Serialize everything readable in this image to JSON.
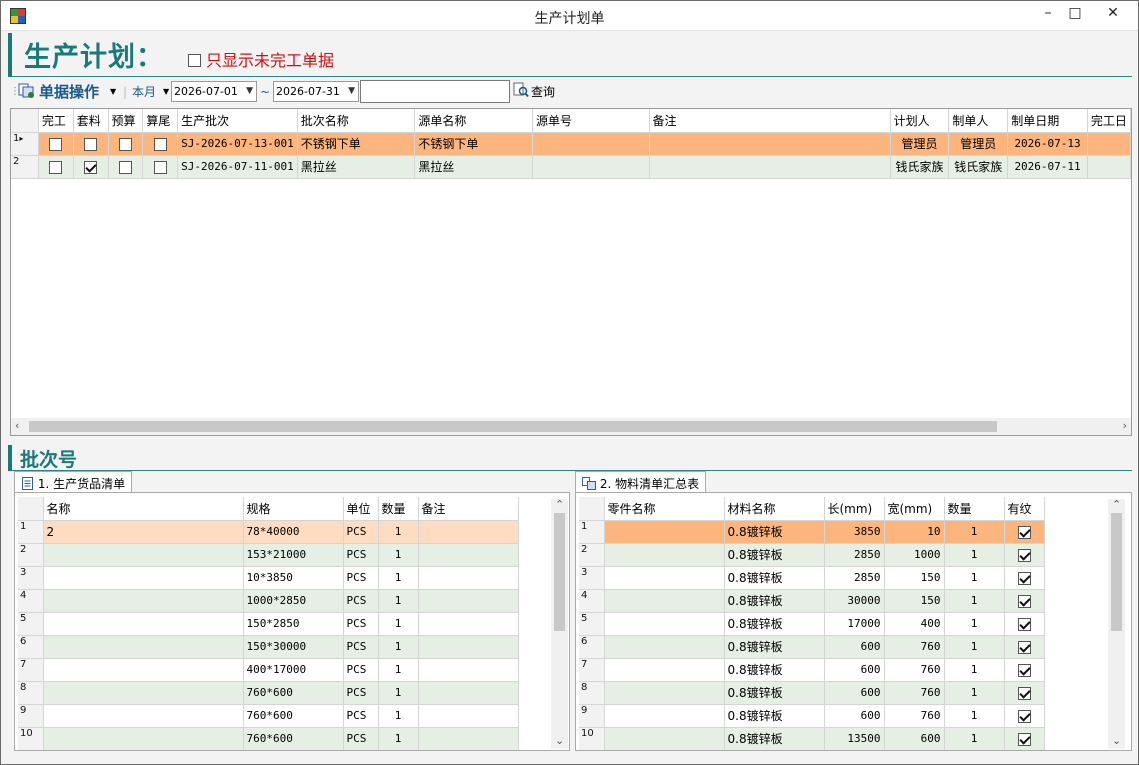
{
  "window": {
    "title": "生产计划单",
    "minimize": "–",
    "maximize": "□",
    "close": "✕"
  },
  "header": {
    "title": "生产计划：",
    "only_unfinished_label": "只显示未完工单据",
    "only_unfinished_checked": false
  },
  "toolbar": {
    "doc_ops_label": "单据操作",
    "period_label": "本月",
    "date_from": "2026-07-01",
    "date_sep": "~",
    "date_to": "2026-07-31",
    "search_value": "",
    "query_label": "查询"
  },
  "plan_grid": {
    "columns": [
      "完工",
      "套料",
      "预算",
      "算尾",
      "生产批次",
      "批次名称",
      "源单名称",
      "源单号",
      "备注",
      "计划人",
      "制单人",
      "制单日期",
      "完工日"
    ],
    "rows": [
      {
        "idx": "1",
        "done": false,
        "nest": false,
        "budget": false,
        "tail": false,
        "batch": "SJ-2026-07-13-001",
        "batch_name": "不锈钢下单",
        "source_name": "不锈钢下单",
        "source_no": "",
        "remark": "",
        "planner": "管理员",
        "creator": "管理员",
        "date": "2026-07-13",
        "finish_date": ""
      },
      {
        "idx": "2",
        "done": false,
        "nest": true,
        "budget": false,
        "tail": false,
        "batch": "SJ-2026-07-11-001",
        "batch_name": "黑拉丝",
        "source_name": "黑拉丝",
        "source_no": "",
        "remark": "",
        "planner": "钱氏家族",
        "creator": "钱氏家族",
        "date": "2026-07-11",
        "finish_date": ""
      }
    ]
  },
  "batch_section": {
    "title": "批次号"
  },
  "tabs": {
    "products": {
      "label": "1. 生产货品清单"
    },
    "materials": {
      "label": "2. 物料清单汇总表"
    }
  },
  "product_grid": {
    "columns": [
      "名称",
      "规格",
      "单位",
      "数量",
      "备注"
    ],
    "rows": [
      {
        "idx": "1",
        "name": "2",
        "spec": "78*40000",
        "unit": "PCS",
        "qty": "1",
        "remark": ""
      },
      {
        "idx": "2",
        "name": "",
        "spec": "153*21000",
        "unit": "PCS",
        "qty": "1",
        "remark": ""
      },
      {
        "idx": "3",
        "name": "",
        "spec": "10*3850",
        "unit": "PCS",
        "qty": "1",
        "remark": ""
      },
      {
        "idx": "4",
        "name": "",
        "spec": "1000*2850",
        "unit": "PCS",
        "qty": "1",
        "remark": ""
      },
      {
        "idx": "5",
        "name": "",
        "spec": "150*2850",
        "unit": "PCS",
        "qty": "1",
        "remark": ""
      },
      {
        "idx": "6",
        "name": "",
        "spec": "150*30000",
        "unit": "PCS",
        "qty": "1",
        "remark": ""
      },
      {
        "idx": "7",
        "name": "",
        "spec": "400*17000",
        "unit": "PCS",
        "qty": "1",
        "remark": ""
      },
      {
        "idx": "8",
        "name": "",
        "spec": "760*600",
        "unit": "PCS",
        "qty": "1",
        "remark": ""
      },
      {
        "idx": "9",
        "name": "",
        "spec": "760*600",
        "unit": "PCS",
        "qty": "1",
        "remark": ""
      },
      {
        "idx": "10",
        "name": "",
        "spec": "760*600",
        "unit": "PCS",
        "qty": "1",
        "remark": ""
      }
    ]
  },
  "material_grid": {
    "columns": [
      "零件名称",
      "材料名称",
      "长(mm)",
      "宽(mm)",
      "数量",
      "有纹"
    ],
    "rows": [
      {
        "idx": "1",
        "part": "",
        "material": "0.8镀锌板",
        "length": "3850",
        "width": "10",
        "qty": "1",
        "grain": true
      },
      {
        "idx": "2",
        "part": "",
        "material": "0.8镀锌板",
        "length": "2850",
        "width": "1000",
        "qty": "1",
        "grain": true
      },
      {
        "idx": "3",
        "part": "",
        "material": "0.8镀锌板",
        "length": "2850",
        "width": "150",
        "qty": "1",
        "grain": true
      },
      {
        "idx": "4",
        "part": "",
        "material": "0.8镀锌板",
        "length": "30000",
        "width": "150",
        "qty": "1",
        "grain": true
      },
      {
        "idx": "5",
        "part": "",
        "material": "0.8镀锌板",
        "length": "17000",
        "width": "400",
        "qty": "1",
        "grain": true
      },
      {
        "idx": "6",
        "part": "",
        "material": "0.8镀锌板",
        "length": "600",
        "width": "760",
        "qty": "1",
        "grain": true
      },
      {
        "idx": "7",
        "part": "",
        "material": "0.8镀锌板",
        "length": "600",
        "width": "760",
        "qty": "1",
        "grain": true
      },
      {
        "idx": "8",
        "part": "",
        "material": "0.8镀锌板",
        "length": "600",
        "width": "760",
        "qty": "1",
        "grain": true
      },
      {
        "idx": "9",
        "part": "",
        "material": "0.8镀锌板",
        "length": "600",
        "width": "760",
        "qty": "1",
        "grain": true
      },
      {
        "idx": "10",
        "part": "",
        "material": "0.8镀锌板",
        "length": "13500",
        "width": "600",
        "qty": "1",
        "grain": true
      }
    ]
  },
  "colors": {
    "accent": "#1a7a78",
    "selected_row": "#fdb57e",
    "selected_row_light": "#fedcc2",
    "alt_row": "#e6efe3",
    "warning_text": "#d01010"
  }
}
